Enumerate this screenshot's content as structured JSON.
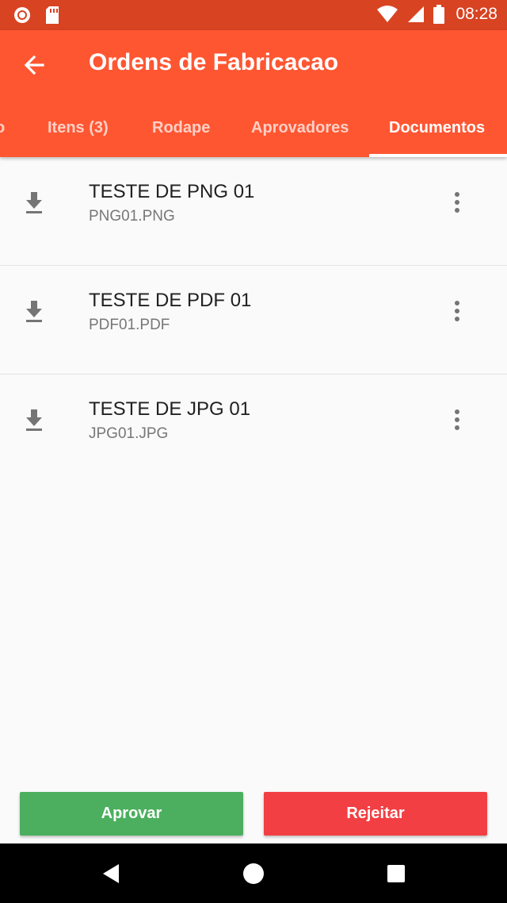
{
  "status_bar": {
    "time": "08:28",
    "icons": [
      "record-icon",
      "sd-card-icon",
      "wifi-icon",
      "signal-icon",
      "battery-icon"
    ]
  },
  "app_bar": {
    "title": "Ordens de Fabricacao",
    "back_icon": "arrow-back-icon",
    "color": "#ff5632"
  },
  "tabs": [
    {
      "label": "o"
    },
    {
      "label": "Itens (3)"
    },
    {
      "label": "Rodape"
    },
    {
      "label": "Aprovadores"
    },
    {
      "label": "Documentos",
      "active": true
    }
  ],
  "documents": [
    {
      "title": "TESTE DE PNG 01",
      "file": "PNG01.PNG"
    },
    {
      "title": "TESTE DE PDF 01",
      "file": "PDF01.PDF"
    },
    {
      "title": "TESTE DE JPG 01",
      "file": "JPG01.JPG"
    }
  ],
  "actions": {
    "approve_label": "Aprovar",
    "reject_label": "Rejeitar",
    "approve_color": "#4caf5f",
    "reject_color": "#f23f43"
  },
  "nav_bar": {
    "icons": [
      "back-triangle-icon",
      "home-circle-icon",
      "recents-square-icon"
    ]
  }
}
